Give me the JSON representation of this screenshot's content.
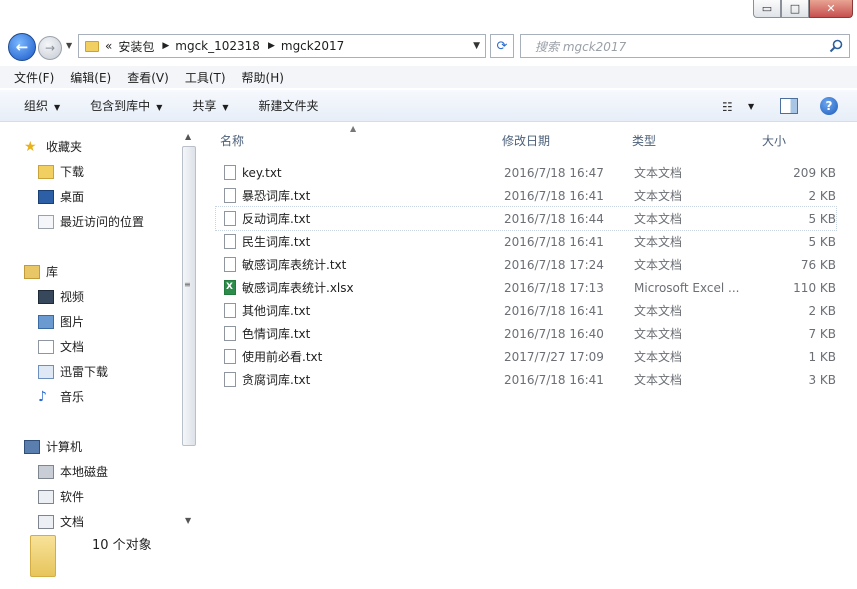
{
  "window": {
    "min_label": "▭",
    "max_label": "□",
    "close_label": "✕"
  },
  "address": {
    "overflow": "«",
    "crumbs": [
      "安装包",
      "mgck_102318",
      "mgck2017"
    ]
  },
  "search": {
    "placeholder": "搜索 mgck2017"
  },
  "menu": [
    "文件(F)",
    "编辑(E)",
    "查看(V)",
    "工具(T)",
    "帮助(H)"
  ],
  "toolbar": {
    "organize": "组织",
    "include_library": "包含到库中",
    "share": "共享",
    "new_folder": "新建文件夹"
  },
  "nav": {
    "favorites": {
      "label": "收藏夹",
      "items": [
        "下载",
        "桌面",
        "最近访问的位置"
      ]
    },
    "libraries": {
      "label": "库",
      "items": [
        "视频",
        "图片",
        "文档",
        "迅雷下载",
        "音乐"
      ]
    },
    "computer": {
      "label": "计算机",
      "items": [
        "本地磁盘",
        "软件",
        "文档"
      ]
    }
  },
  "columns": {
    "name": "名称",
    "date": "修改日期",
    "type": "类型",
    "size": "大小"
  },
  "files": [
    {
      "name": "key.txt",
      "date": "2016/7/18 16:47",
      "type": "文本文档",
      "size": "209 KB"
    },
    {
      "name": "暴恐词库.txt",
      "date": "2016/7/18 16:41",
      "type": "文本文档",
      "size": "2 KB"
    },
    {
      "name": "反动词库.txt",
      "date": "2016/7/18 16:44",
      "type": "文本文档",
      "size": "5 KB"
    },
    {
      "name": "民生词库.txt",
      "date": "2016/7/18 16:41",
      "type": "文本文档",
      "size": "5 KB"
    },
    {
      "name": "敏感词库表统计.txt",
      "date": "2016/7/18 17:24",
      "type": "文本文档",
      "size": "76 KB"
    },
    {
      "name": "敏感词库表统计.xlsx",
      "date": "2016/7/18 17:13",
      "type": "Microsoft Excel ...",
      "size": "110 KB"
    },
    {
      "name": "其他词库.txt",
      "date": "2016/7/18 16:41",
      "type": "文本文档",
      "size": "2 KB"
    },
    {
      "name": "色情词库.txt",
      "date": "2016/7/18 16:40",
      "type": "文本文档",
      "size": "7 KB"
    },
    {
      "name": "使用前必看.txt",
      "date": "2017/7/27 17:09",
      "type": "文本文档",
      "size": "1 KB"
    },
    {
      "name": "贪腐词库.txt",
      "date": "2016/7/18 16:41",
      "type": "文本文档",
      "size": "3 KB"
    }
  ],
  "status": {
    "count": "10 个对象"
  }
}
